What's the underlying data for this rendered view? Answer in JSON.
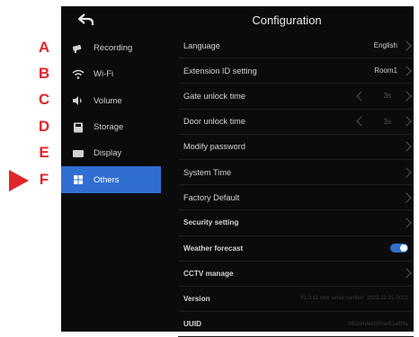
{
  "annotations": {
    "letters": [
      "A",
      "B",
      "C",
      "D",
      "E",
      "F"
    ],
    "pointer_target": "F"
  },
  "header": {
    "title": "Configuration"
  },
  "sidebar": {
    "items": [
      {
        "label": "Recording",
        "icon": "camera-icon"
      },
      {
        "label": "Wi-Fi",
        "icon": "wifi-icon"
      },
      {
        "label": "Volume",
        "icon": "speaker-icon"
      },
      {
        "label": "Storage",
        "icon": "storage-icon"
      },
      {
        "label": "Display",
        "icon": "display-icon"
      },
      {
        "label": "Others",
        "icon": "grid-icon",
        "active": true
      }
    ]
  },
  "settings": {
    "language": {
      "label": "Language",
      "value": "English"
    },
    "extension": {
      "label": "Extension ID setting",
      "value": "Room1"
    },
    "gate": {
      "label": "Gate unlock time",
      "value": "3s"
    },
    "door": {
      "label": "Door unlock time",
      "value": "3s"
    },
    "password": {
      "label": "Modify  password"
    },
    "system_time": {
      "label": "System Time"
    },
    "factory": {
      "label": "Factory Default"
    },
    "security": {
      "label": "Security setting"
    },
    "weather": {
      "label": "Weather forecast",
      "enabled": true
    },
    "cctv": {
      "label": "CCTV manage"
    },
    "version": {
      "label": "Version",
      "value": "V1.0.11 new serial number: 2023-12-31-0001"
    },
    "uuid": {
      "label": "UUID",
      "value": "bfd2d4deeb59ae61a8bfa"
    }
  },
  "colors": {
    "accent": "#2f6fd2",
    "annotation": "#e0262b",
    "screen_bg": "#0b0b0b"
  }
}
